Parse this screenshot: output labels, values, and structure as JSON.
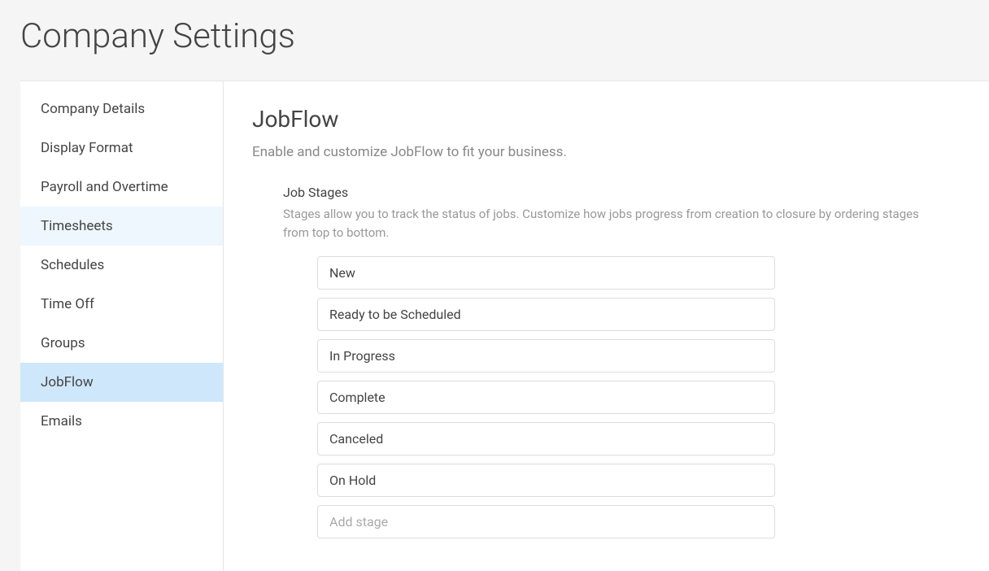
{
  "page": {
    "title": "Company Settings"
  },
  "sidebar": {
    "items": [
      {
        "label": "Company Details",
        "state": ""
      },
      {
        "label": "Display Format",
        "state": ""
      },
      {
        "label": "Payroll and Overtime",
        "state": ""
      },
      {
        "label": "Timesheets",
        "state": "highlighted"
      },
      {
        "label": "Schedules",
        "state": ""
      },
      {
        "label": "Time Off",
        "state": ""
      },
      {
        "label": "Groups",
        "state": ""
      },
      {
        "label": "JobFlow",
        "state": "active"
      },
      {
        "label": "Emails",
        "state": ""
      }
    ]
  },
  "main": {
    "title": "JobFlow",
    "description": "Enable and customize JobFlow to fit your business."
  },
  "stages_section": {
    "title": "Job Stages",
    "description": "Stages allow you to track the status of jobs. Customize how jobs progress from creation to closure by ordering stages from top to bottom.",
    "stages": [
      "New",
      "Ready to be Scheduled",
      "In Progress",
      "Complete",
      "Canceled",
      "On Hold"
    ],
    "add_placeholder": "Add stage"
  }
}
